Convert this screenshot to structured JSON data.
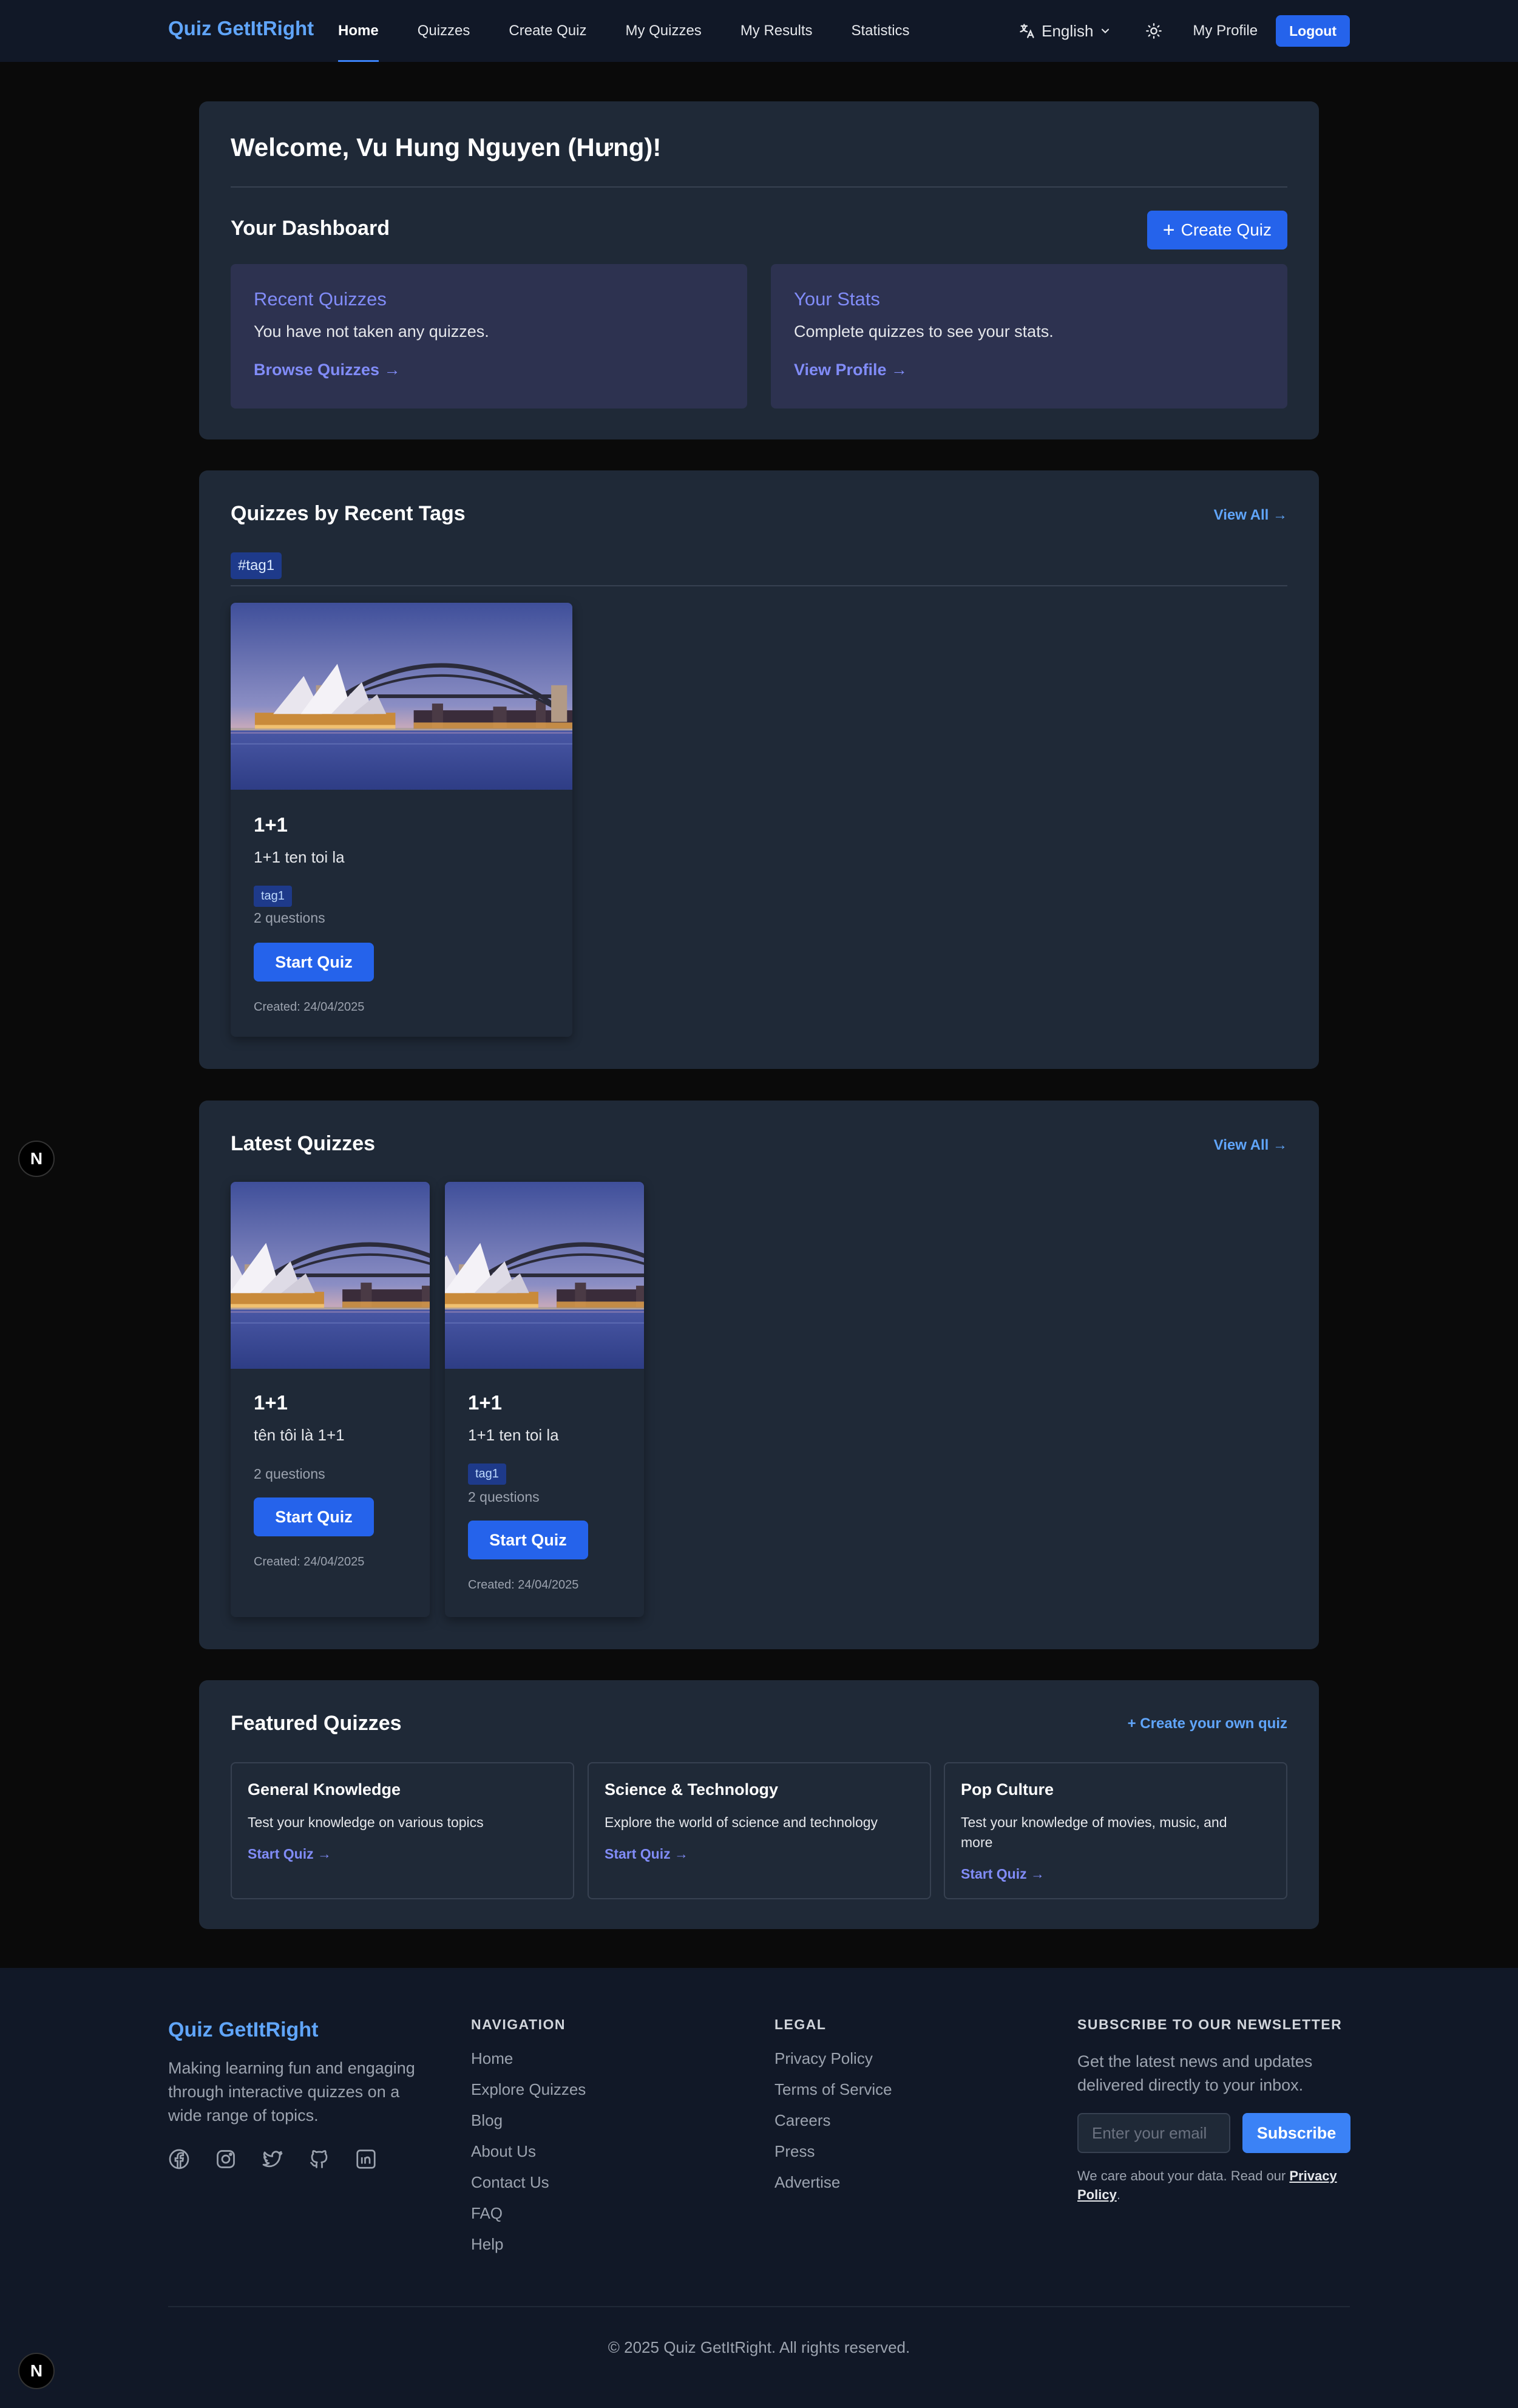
{
  "brand": "Quiz GetItRight",
  "nav": {
    "links": [
      "Home",
      "Quizzes",
      "Create Quiz",
      "My Quizzes",
      "My Results",
      "Statistics"
    ],
    "language": "English",
    "profile": "My Profile",
    "logout": "Logout"
  },
  "welcome": {
    "title": "Welcome, Vu Hung Nguyen (Hưng)!",
    "dashboard_title": "Your Dashboard",
    "create_quiz": "Create Quiz",
    "recent": {
      "title": "Recent Quizzes",
      "text": "You have not taken any quizzes.",
      "link": "Browse Quizzes →"
    },
    "stats": {
      "title": "Your Stats",
      "text": "Complete quizzes to see your stats.",
      "link": "View Profile →"
    }
  },
  "tags_section": {
    "title": "Quizzes by Recent Tags",
    "view_all": "View All →",
    "active_tag": "#tag1",
    "cards": [
      {
        "title": "1+1",
        "description": "1+1 ten toi la",
        "tag": "tag1",
        "questions": "2 questions",
        "button": "Start Quiz",
        "created": "Created: 24/04/2025"
      }
    ]
  },
  "latest_section": {
    "title": "Latest Quizzes",
    "view_all": "View All →",
    "cards": [
      {
        "title": "1+1",
        "description": "tên tôi là 1+1",
        "questions": "2 questions",
        "button": "Start Quiz",
        "created": "Created: 24/04/2025"
      },
      {
        "title": "1+1",
        "description": "1+1 ten toi la",
        "tag": "tag1",
        "questions": "2 questions",
        "button": "Start Quiz",
        "created": "Created: 24/04/2025"
      }
    ]
  },
  "featured_section": {
    "title": "Featured Quizzes",
    "create_own": "Create your own quiz",
    "items": [
      {
        "title": "General Knowledge",
        "text": "Test your knowledge on various topics",
        "link": "Start Quiz →"
      },
      {
        "title": "Science & Technology",
        "text": "Explore the world of science and technology",
        "link": "Start Quiz →"
      },
      {
        "title": "Pop Culture",
        "text": "Test your knowledge of movies, music, and more",
        "link": "Start Quiz →"
      }
    ]
  },
  "footer": {
    "brand": "Quiz GetItRight",
    "about": "Making learning fun and engaging through interactive quizzes on a wide range of topics.",
    "socials": [
      "facebook-icon",
      "instagram-icon",
      "twitter-icon",
      "github-icon",
      "linkedin-icon"
    ],
    "navigation": {
      "heading": "NAVIGATION",
      "items": [
        "Home",
        "Explore Quizzes",
        "Blog",
        "About Us",
        "Contact Us",
        "FAQ",
        "Help"
      ]
    },
    "legal": {
      "heading": "LEGAL",
      "items": [
        "Privacy Policy",
        "Terms of Service",
        "Careers",
        "Press",
        "Advertise"
      ]
    },
    "newsletter": {
      "heading": "SUBSCRIBE TO OUR NEWSLETTER",
      "text": "Get the latest news and updates delivered directly to your inbox.",
      "placeholder": "Enter your email",
      "button": "Subscribe",
      "note": "We care about your data. Read our",
      "note_link": "Privacy Policy"
    },
    "copyright": "© 2025 Quiz GetItRight. All rights reserved."
  },
  "badge": "N",
  "colors": {
    "accent": "#2563eb",
    "link": "#60a5fa",
    "indigo": "#818cf8",
    "panel": "#1f2937",
    "page": "#0a0a0a"
  }
}
